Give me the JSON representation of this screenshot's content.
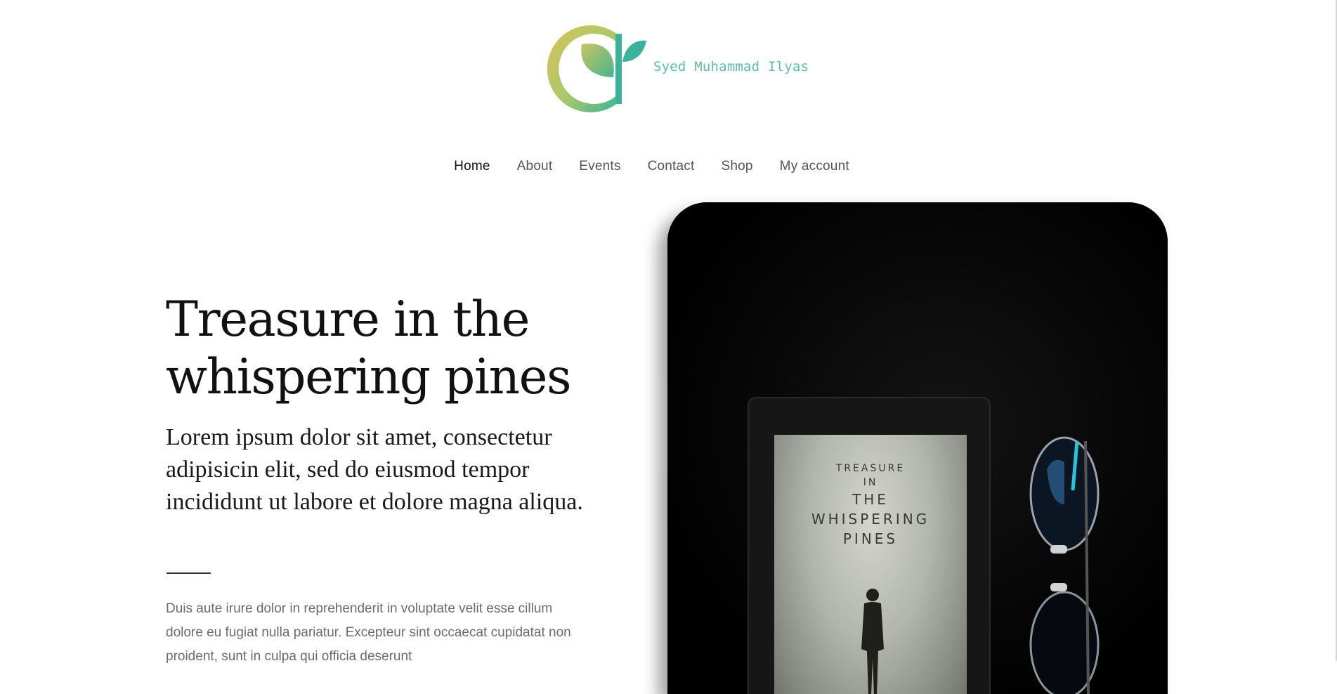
{
  "brand": {
    "name": "Syed Muhammad Ilyas",
    "colors": {
      "teal": "#3bb39a",
      "gold": "#d9c15a"
    }
  },
  "nav": {
    "items": [
      {
        "label": "Home",
        "active": true
      },
      {
        "label": "About"
      },
      {
        "label": "Events"
      },
      {
        "label": "Contact"
      },
      {
        "label": "Shop"
      },
      {
        "label": "My account"
      }
    ]
  },
  "hero": {
    "title": "Treasure in the whispering pines",
    "lead": "Lorem ipsum dolor sit amet, consectetur adipisicin elit, sed do eiusmod tempor incididunt ut labore et dolore magna aliqua.",
    "body": "Duis aute irure dolor in reprehenderit in voluptate velit esse cillum dolore eu fugiat nulla pariatur. Excepteur sint occaecat cupidatat non proident, sunt in culpa qui officia deserunt"
  },
  "image": {
    "book_lines": [
      "TREASURE",
      "IN",
      "THE",
      "WHISPERING",
      "PINES"
    ]
  }
}
